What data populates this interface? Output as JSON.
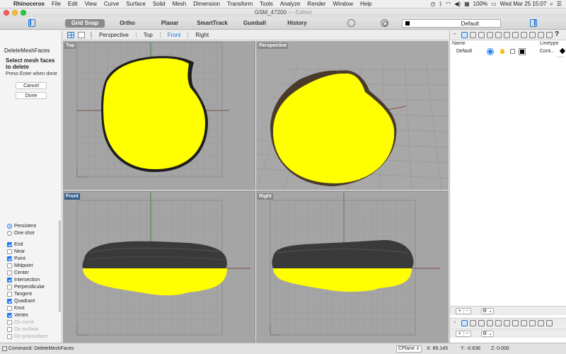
{
  "menubar": {
    "items": [
      "Rhinoceros",
      "File",
      "Edit",
      "View",
      "Curve",
      "Surface",
      "Solid",
      "Mesh",
      "Dimension",
      "Transform",
      "Tools",
      "Analyze",
      "Render",
      "Window",
      "Help"
    ],
    "battery": "100%",
    "clock": "Wed Mar 25  15:07"
  },
  "window": {
    "title": "GSM_47200",
    "edited": "— Edited"
  },
  "toolbar": {
    "snaps": [
      {
        "label": "Grid Snap",
        "on": true
      },
      {
        "label": "Ortho",
        "on": false
      },
      {
        "label": "Planar",
        "on": false
      },
      {
        "label": "SmartTrack",
        "on": false
      },
      {
        "label": "Gumball",
        "on": false
      },
      {
        "label": "History",
        "on": false
      }
    ],
    "layer": "Default"
  },
  "command_panel": {
    "name": "DeleteMeshFaces",
    "prompt": "Select mesh faces to delete",
    "hint": "Press Enter when done",
    "cancel": "Cancel",
    "done": "Done"
  },
  "osnap": {
    "persistent": "Persistent",
    "one_shot": "One shot",
    "items": [
      {
        "label": "End",
        "checked": true
      },
      {
        "label": "Near",
        "checked": false
      },
      {
        "label": "Point",
        "checked": true
      },
      {
        "label": "Midpoint",
        "checked": false
      },
      {
        "label": "Center",
        "checked": false
      },
      {
        "label": "Intersection",
        "checked": true
      },
      {
        "label": "Perpendicular",
        "checked": false
      },
      {
        "label": "Tangent",
        "checked": false
      },
      {
        "label": "Quadrant",
        "checked": true
      },
      {
        "label": "Knot",
        "checked": false
      },
      {
        "label": "Vertex",
        "checked": true
      },
      {
        "label": "On curve",
        "checked": false,
        "dim": true
      },
      {
        "label": "On surface",
        "checked": false,
        "dim": true
      },
      {
        "label": "On polysurface",
        "checked": false,
        "dim": true
      }
    ]
  },
  "viewport_tabs": [
    "Perspective",
    "Top",
    "Front",
    "Right"
  ],
  "active_tab": "Front",
  "viewports": {
    "top": "Top",
    "perspective": "Perspective",
    "front": "Front",
    "right": "Right"
  },
  "layers": {
    "col_name": "Name",
    "col_linetype": "Linetype",
    "rows": [
      {
        "name": "Default",
        "linetype": "Cont..."
      }
    ]
  },
  "status": {
    "command": "Command: DeleteMeshFaces",
    "cplane": "CPlane",
    "x": "X: 89.145",
    "y": "Y: -0.636",
    "z": "Z: 0.000"
  },
  "colors": {
    "selection": "#ffff00",
    "accent": "#1c74d9",
    "viewport_bg": "#a5a5a5",
    "mesh": "#3a3a3a"
  }
}
